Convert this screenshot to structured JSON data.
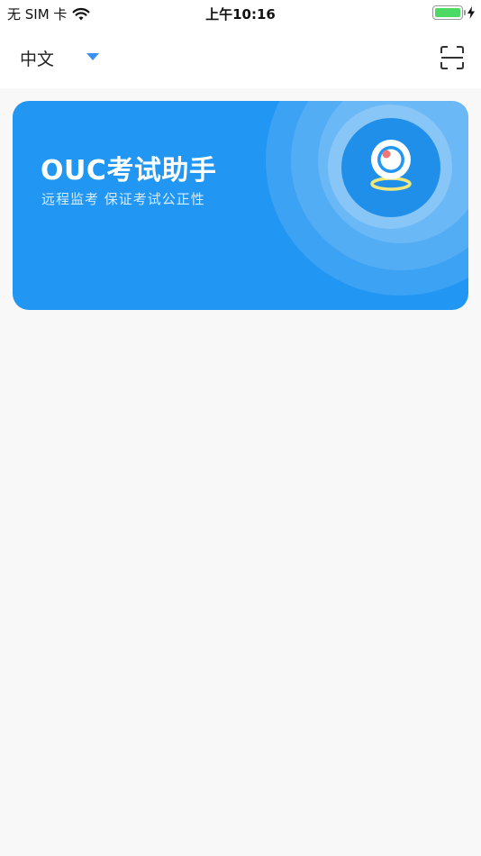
{
  "status_bar": {
    "carrier": "无 SIM 卡",
    "time": "上午10:16",
    "icons": [
      "wifi-icon",
      "battery-icon",
      "charging-bolt-icon"
    ]
  },
  "header": {
    "language": "中文",
    "scan_icon": "scan-icon"
  },
  "card": {
    "title": "OUC考试助手",
    "subtitle": "远程监考  保证考试公正性",
    "icon": "camera-icon",
    "color": "#2196f3"
  },
  "colors": {
    "accent": "#3a8ff0",
    "card_bg": "#2196f3",
    "battery": "#4cd964",
    "page_bg": "#f8f8f8"
  }
}
